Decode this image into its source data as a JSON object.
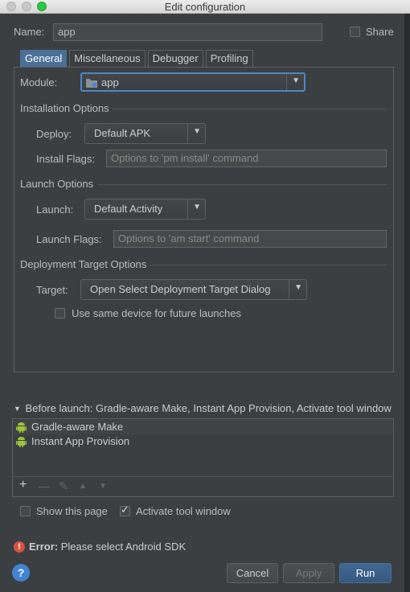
{
  "window": {
    "title": "Edit configuration"
  },
  "name_field": {
    "label": "Name:",
    "value": "app"
  },
  "share": {
    "label": "Share",
    "checked": false
  },
  "tabs": [
    {
      "label": "General",
      "active": true
    },
    {
      "label": "Miscellaneous",
      "active": false
    },
    {
      "label": "Debugger",
      "active": false
    },
    {
      "label": "Profiling",
      "active": false
    }
  ],
  "module": {
    "label": "Module:",
    "value": "app",
    "icon": "module-folder-icon"
  },
  "installation": {
    "section_title": "Installation Options",
    "deploy_label": "Deploy:",
    "deploy_value": "Default APK",
    "install_flags_label": "Install Flags:",
    "install_flags_placeholder": "Options to 'pm install' command"
  },
  "launch": {
    "section_title": "Launch Options",
    "launch_label": "Launch:",
    "launch_value": "Default Activity",
    "launch_flags_label": "Launch Flags:",
    "launch_flags_placeholder": "Options to 'am start' command"
  },
  "deployment_target": {
    "section_title": "Deployment Target Options",
    "target_label": "Target:",
    "target_value": "Open Select Deployment Target Dialog",
    "same_device_label": "Use same device for future launches",
    "same_device_checked": false
  },
  "before_launch": {
    "header": "Before launch: Gradle-aware Make, Instant App Provision, Activate tool window",
    "items": [
      {
        "label": "Gradle-aware Make",
        "icon": "android-icon"
      },
      {
        "label": "Instant App Provision",
        "icon": "android-icon"
      }
    ],
    "toolbar": {
      "add": "+",
      "remove": "—",
      "edit": "✎",
      "up": "▲",
      "down": "▼"
    }
  },
  "options": {
    "show_this_page_label": "Show this page",
    "show_this_page_checked": false,
    "activate_tool_window_label": "Activate tool window",
    "activate_tool_window_checked": true
  },
  "error": {
    "prefix": "Error:",
    "message": "Please select Android SDK"
  },
  "buttons": {
    "help": "?",
    "cancel": "Cancel",
    "apply": "Apply",
    "run": "Run"
  },
  "colors": {
    "background": "#3c3f41",
    "active_tab": "#4a6f99",
    "focus_border": "#4a88c7",
    "error_red": "#d9503f",
    "android_green": "#9fc33a"
  }
}
